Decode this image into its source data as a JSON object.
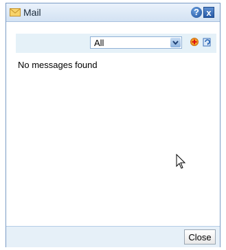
{
  "window": {
    "title": "Mail",
    "help_label": "?",
    "close_label": "x"
  },
  "filter": {
    "selected": "All"
  },
  "messages": {
    "empty_text": "No messages found"
  },
  "footer": {
    "close_label": "Close"
  },
  "icons": {
    "title": "envelope-icon",
    "help": "help-icon",
    "close": "close-icon",
    "dropdown": "chevron-down-icon",
    "add": "add-icon",
    "refresh": "refresh-icon",
    "cursor": "mouse-pointer-icon"
  },
  "colors": {
    "accent": "#2659a6",
    "titlebar": "#d3e2f3",
    "filterbar": "#e5f1f8",
    "footer": "#e6f0f8"
  }
}
